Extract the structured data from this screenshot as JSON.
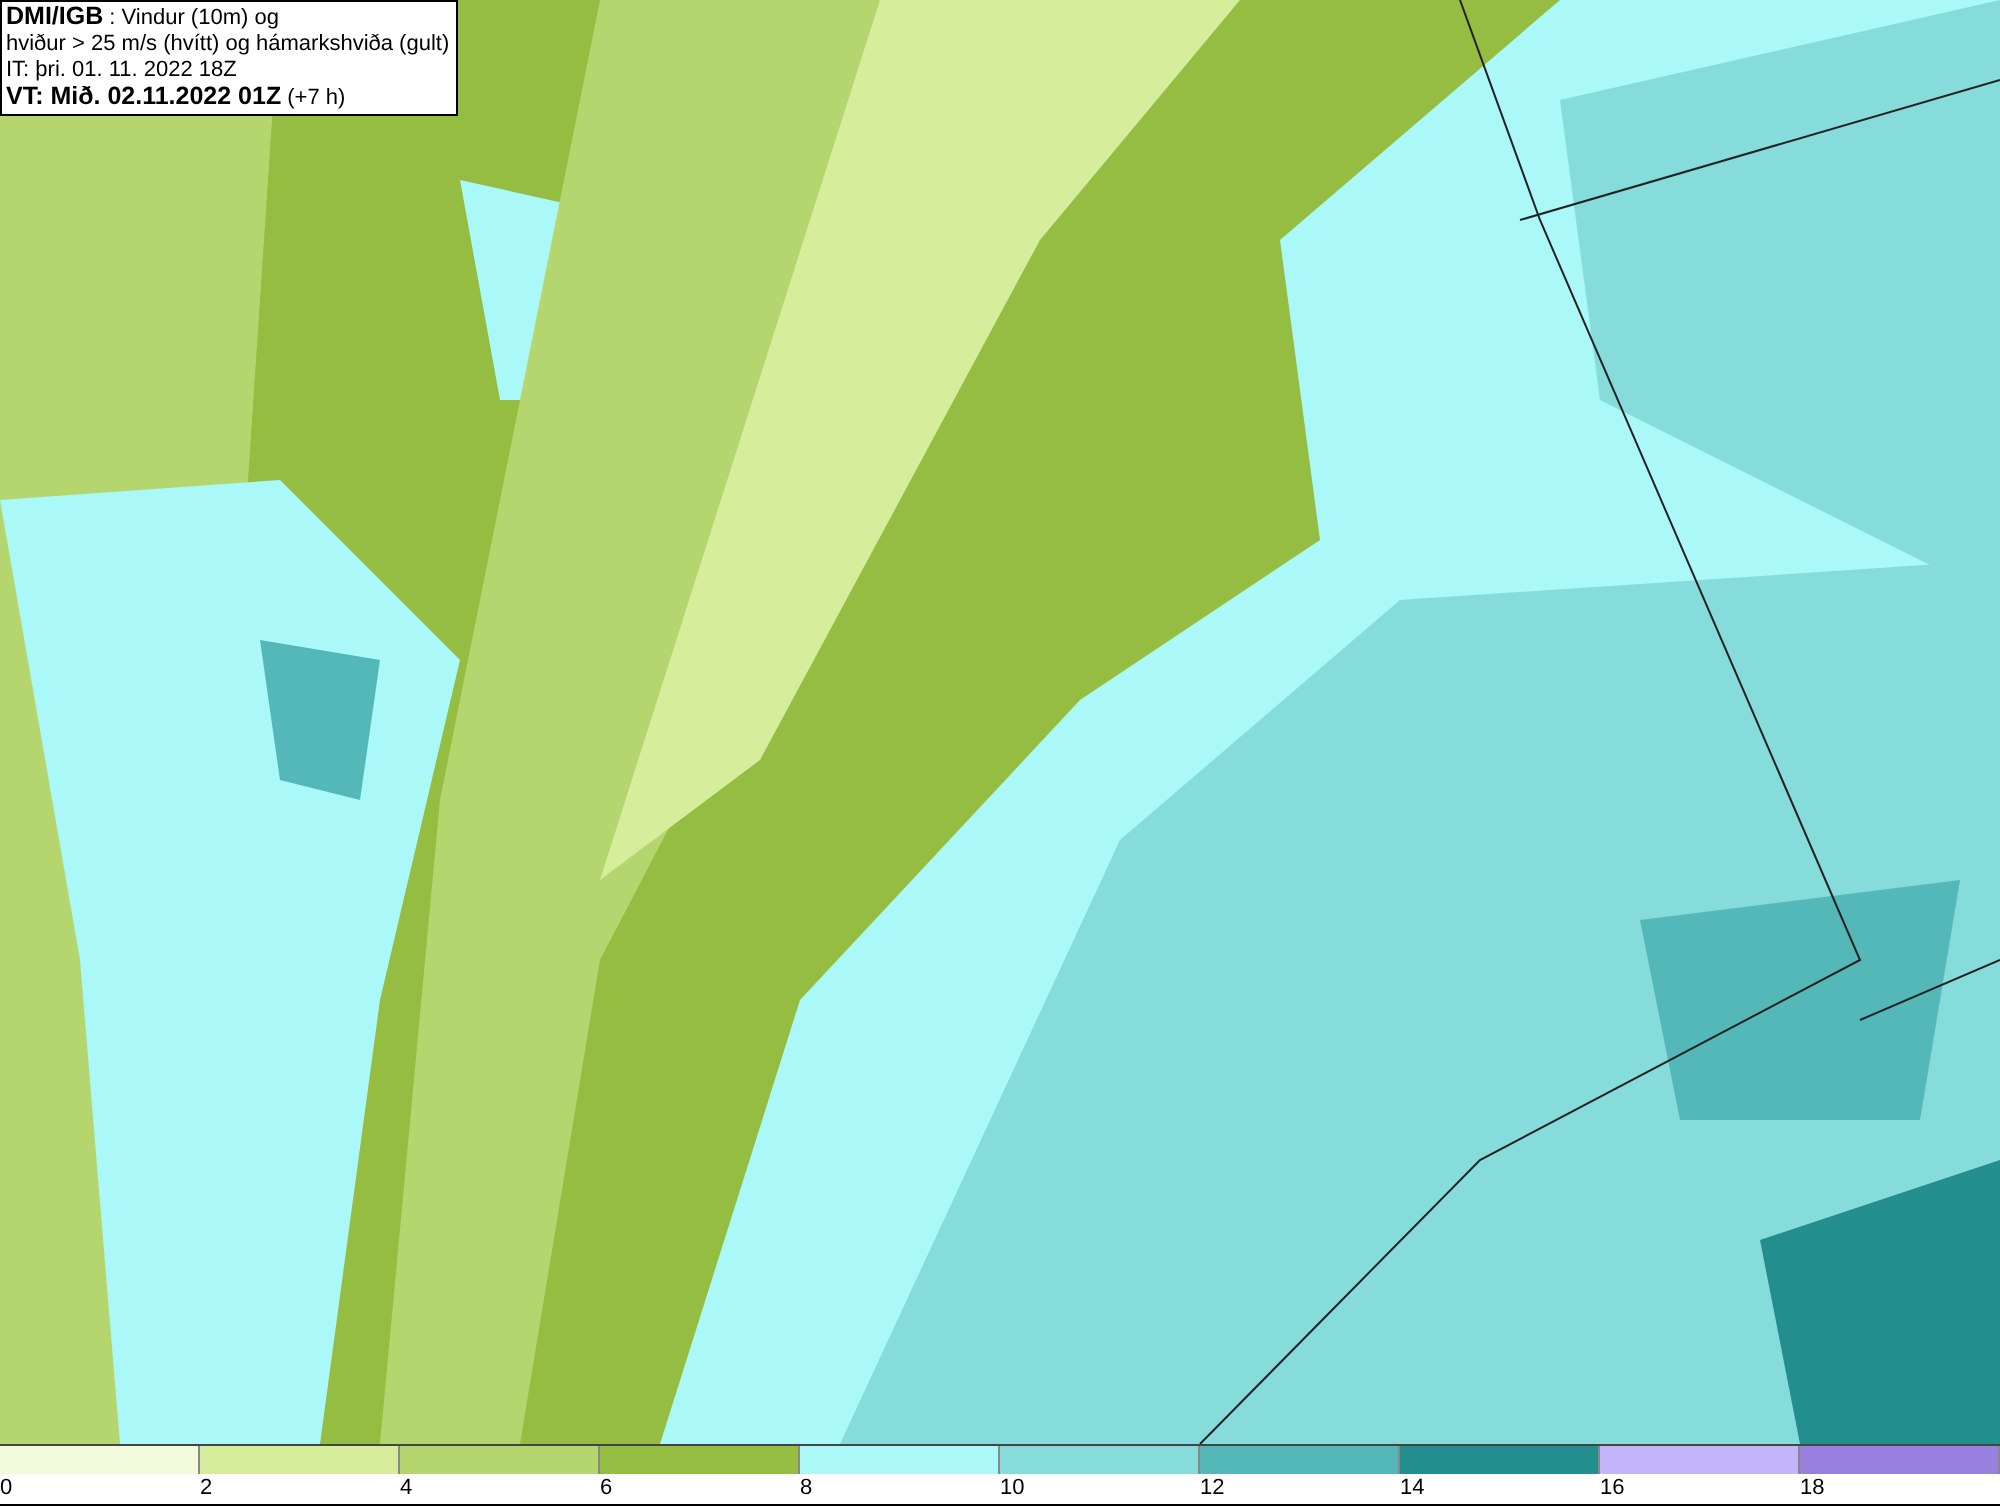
{
  "title_box": {
    "lines": [
      "**DMI/IGB** : Vindur (10m) og",
      "hviður > 25 m/s (hvítt) og hámarkshviða (gult)",
      "IT: þri. 01. 11. 2022 18Z",
      "**VT: Mið. 02.11.2022 01Z** (+7 h)"
    ]
  },
  "legend": [
    {
      "label": "0",
      "color": "#f4fadc"
    },
    {
      "label": "2",
      "color": "#d6ee9c"
    },
    {
      "label": "4",
      "color": "#b5d66e"
    },
    {
      "label": "6",
      "color": "#95bd42"
    },
    {
      "label": "8",
      "color": "#aaf8f8"
    },
    {
      "label": "10",
      "color": "#86dbdb"
    },
    {
      "label": "12",
      "color": "#55b8b8"
    },
    {
      "label": "14",
      "color": "#228e8e"
    },
    {
      "label": "16",
      "color": "#c4b4fb"
    },
    {
      "label": "18",
      "color": "#9880de"
    }
  ]
}
